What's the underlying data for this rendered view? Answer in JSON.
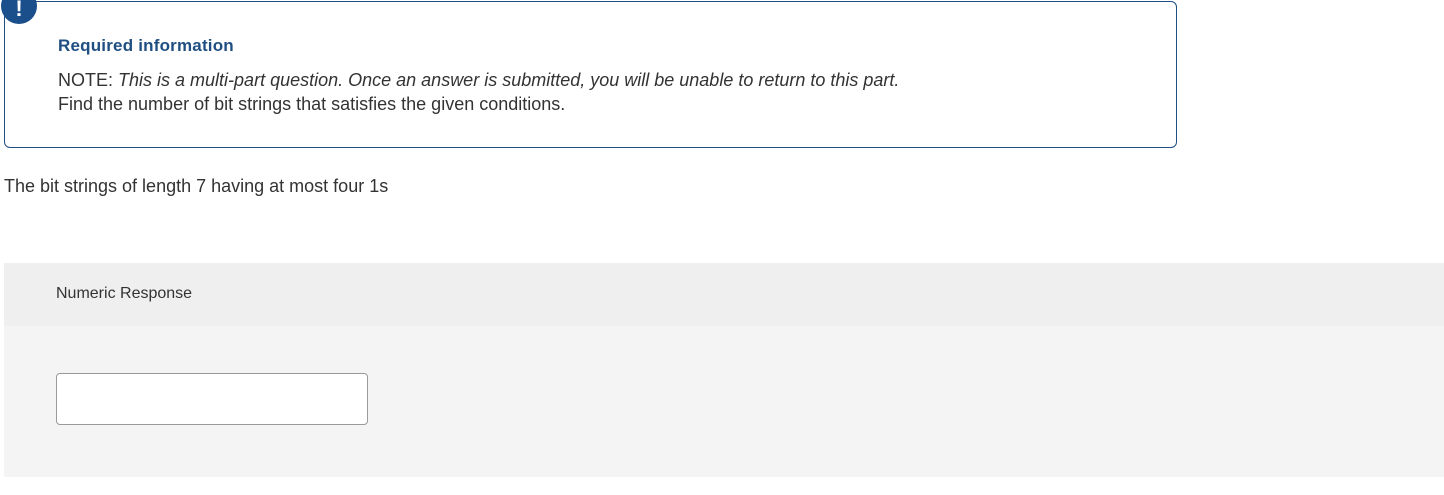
{
  "info": {
    "badge_symbol": "!",
    "title": "Required information",
    "note_label": "NOTE:",
    "note_text": "This is a multi-part question. Once an answer is submitted, you will be unable to return to this part.",
    "instruction": "Find the number of bit strings that satisfies the given conditions."
  },
  "question": {
    "text": "The bit strings of length 7 having at most four 1s"
  },
  "response": {
    "label": "Numeric Response",
    "value": "",
    "placeholder": ""
  },
  "colors": {
    "accent": "#1f4e82",
    "badge": "#1a4f8b",
    "panel_bg": "#f4f4f4",
    "header_bg": "#efefef"
  }
}
